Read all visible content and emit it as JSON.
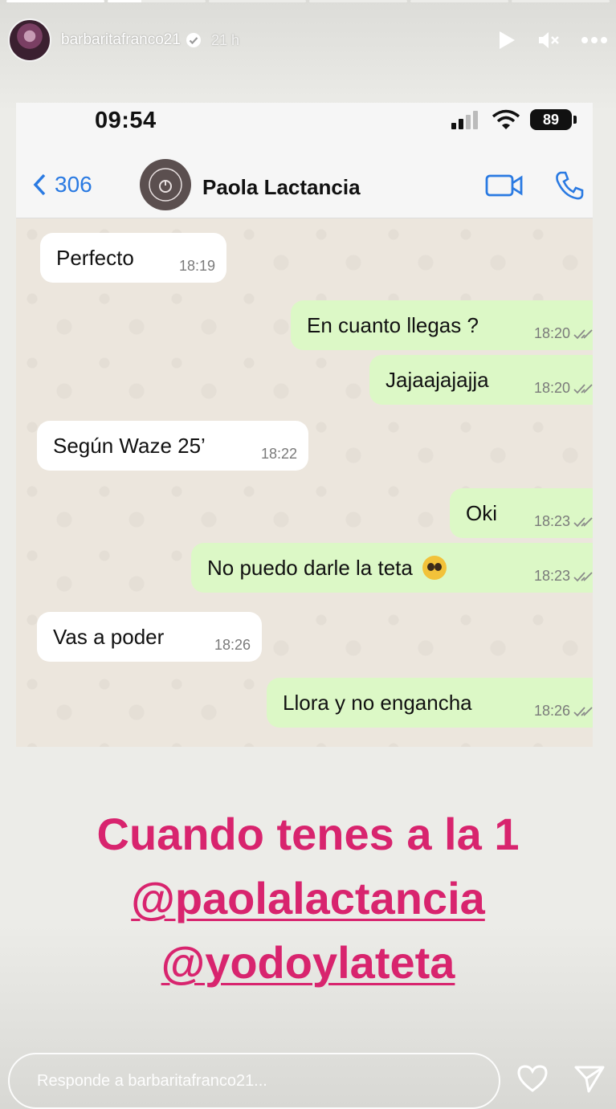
{
  "story": {
    "progress": [
      1,
      1,
      0,
      0,
      0,
      0
    ],
    "username": "barbaritafranco21",
    "time_ago": "21 h",
    "icons": [
      "verified-badge-icon",
      "play-icon",
      "mute-icon",
      "more-icon"
    ]
  },
  "screenshot": {
    "status_time": "09:54",
    "battery": "89",
    "back_count": "306",
    "contact_name": "Paola Lactancia",
    "messages": [
      {
        "dir": "in",
        "text": "Perfecto",
        "time": "18:19"
      },
      {
        "dir": "out",
        "text": "En cuanto llegas ?",
        "time": "18:20"
      },
      {
        "dir": "out",
        "text": "Jajaajajajja",
        "time": "18:20"
      },
      {
        "dir": "in",
        "text": "Según Waze 25’",
        "time": "18:22"
      },
      {
        "dir": "out",
        "text": "Oki",
        "time": "18:23"
      },
      {
        "dir": "out",
        "text": "No puedo darle la teta",
        "time": "18:23"
      },
      {
        "dir": "in",
        "text": "Vas a poder",
        "time": "18:26"
      },
      {
        "dir": "out",
        "text": "Llora y no engancha",
        "time": "18:26"
      }
    ]
  },
  "caption": {
    "line1": "Cuando tenes a la 1",
    "mention1": "@paolalactancia",
    "mention2": "@yodoylateta"
  },
  "reply": {
    "placeholder": "Responde a barbaritafranco21..."
  },
  "colors": {
    "accent_pink": "#d8246e",
    "ios_blue": "#2a7ae2",
    "bubble_out": "#dcf8c6"
  }
}
